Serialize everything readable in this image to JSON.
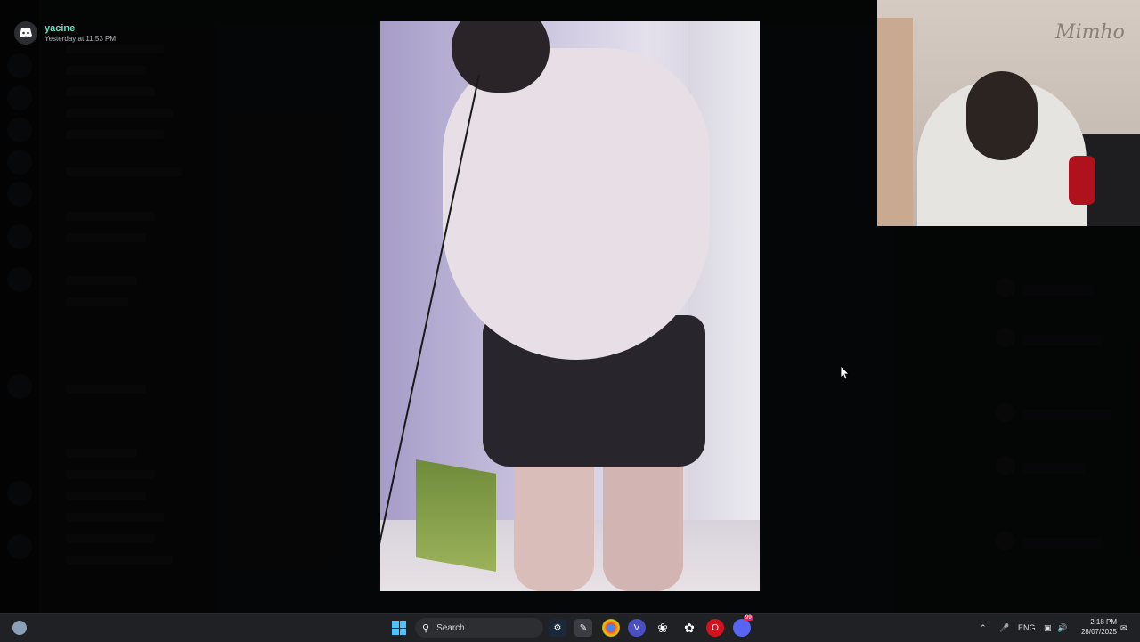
{
  "author": {
    "name": "yacine",
    "timestamp": "Yesterday at 11:53 PM"
  },
  "webcam": {
    "brand_text": "Mimho"
  },
  "taskbar": {
    "search_label": "Search",
    "language": "ENG",
    "time": "2:18 PM",
    "date": "28/07/2025",
    "discord_badge": "99"
  },
  "colors": {
    "author_name": "#5fe0c0",
    "windows_accent": "#4cc2ff",
    "discord": "#5865f2"
  },
  "icons": {
    "author_logo": "discord-icon",
    "cursor": "mouse-pointer-icon"
  }
}
